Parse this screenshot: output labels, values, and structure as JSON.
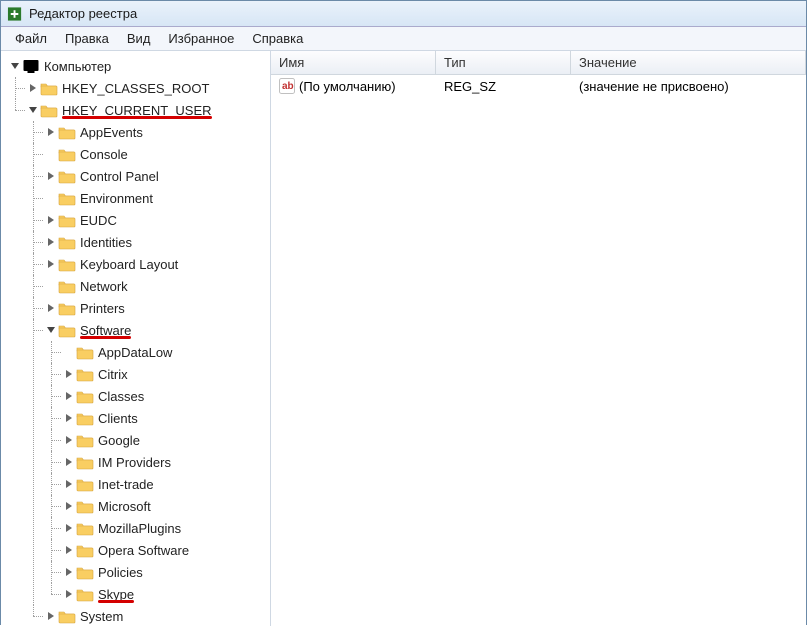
{
  "title": "Редактор реестра",
  "menu": {
    "file": "Файл",
    "edit": "Правка",
    "view": "Вид",
    "favorites": "Избранное",
    "help": "Справка"
  },
  "cols": {
    "name": "Имя",
    "type": "Тип",
    "value": "Значение"
  },
  "row": {
    "name": "(По умолчанию)",
    "type": "REG_SZ",
    "value": "(значение не присвоено)"
  },
  "tree": {
    "computer": "Компьютер",
    "hkcr": "HKEY_CLASSES_ROOT",
    "hkcu": "HKEY_CURRENT_USER",
    "hkcu_children": {
      "appevents": "AppEvents",
      "console": "Console",
      "controlpanel": "Control Panel",
      "environment": "Environment",
      "eudc": "EUDC",
      "identities": "Identities",
      "keyboardlayout": "Keyboard Layout",
      "network": "Network",
      "printers": "Printers",
      "software": "Software",
      "system": "System"
    },
    "software_children": {
      "appdatalow": "AppDataLow",
      "citrix": "Citrix",
      "classes": "Classes",
      "clients": "Clients",
      "google": "Google",
      "improviders": "IM Providers",
      "inettrade": "Inet-trade",
      "microsoft": "Microsoft",
      "mozillaplugins": "MozillaPlugins",
      "operasoftware": "Opera Software",
      "policies": "Policies",
      "skype": "Skype"
    }
  }
}
